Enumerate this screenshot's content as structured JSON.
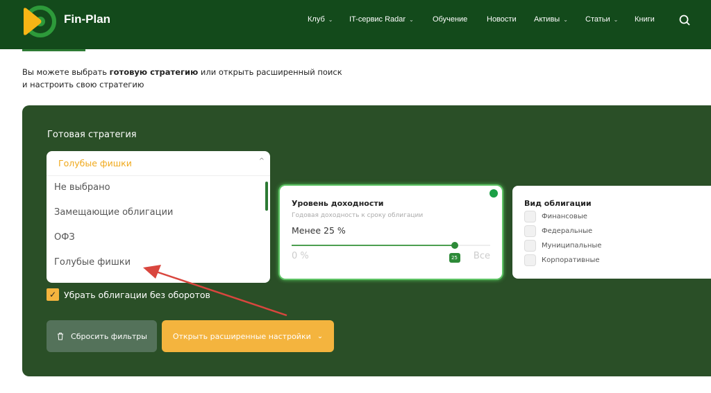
{
  "header": {
    "brand": "Fin-Plan",
    "nav": [
      {
        "label": "Клуб",
        "dropdown": true
      },
      {
        "label": "IT-сервис Radar",
        "dropdown": true
      },
      {
        "label": "Обучение",
        "dropdown": false
      },
      {
        "label": "Новости",
        "dropdown": false
      },
      {
        "label": "Активы",
        "dropdown": true
      },
      {
        "label": "Статьи",
        "dropdown": true
      },
      {
        "label": "Книги",
        "dropdown": false
      }
    ]
  },
  "intro": {
    "pre": "Вы можете выбрать ",
    "bold": "готовую стратегию",
    "post": " или открыть расширенный поиск",
    "line2": "и настроить свою стратегию"
  },
  "strategy": {
    "title": "Готовая стратегия",
    "selected": "Голубые фишки",
    "options": [
      "Не выбрано",
      "Замещающие облигации",
      "ОФЗ",
      "Голубые фишки"
    ]
  },
  "yield": {
    "title": "Уровень доходности",
    "subtitle": "Годовая доходность к сроку облигации",
    "value": "Менее 25 %",
    "min": "0 %",
    "max": "Все",
    "slider_value": "25",
    "slider_fraction": 0.82
  },
  "bond_type": {
    "title": "Вид облигации",
    "options": [
      "Финансовые",
      "Федеральные",
      "Муниципальные",
      "Корпоративные"
    ]
  },
  "no_turnover": {
    "label": "Убрать облигации без оборотов",
    "checked": true
  },
  "buttons": {
    "reset": "Сбросить фильтры",
    "advanced": "Открыть расширенные настройки"
  },
  "colors": {
    "header": "#134a1b",
    "panel": "#2a4f27",
    "accent": "#f4b43e",
    "green": "#2d8a38"
  }
}
